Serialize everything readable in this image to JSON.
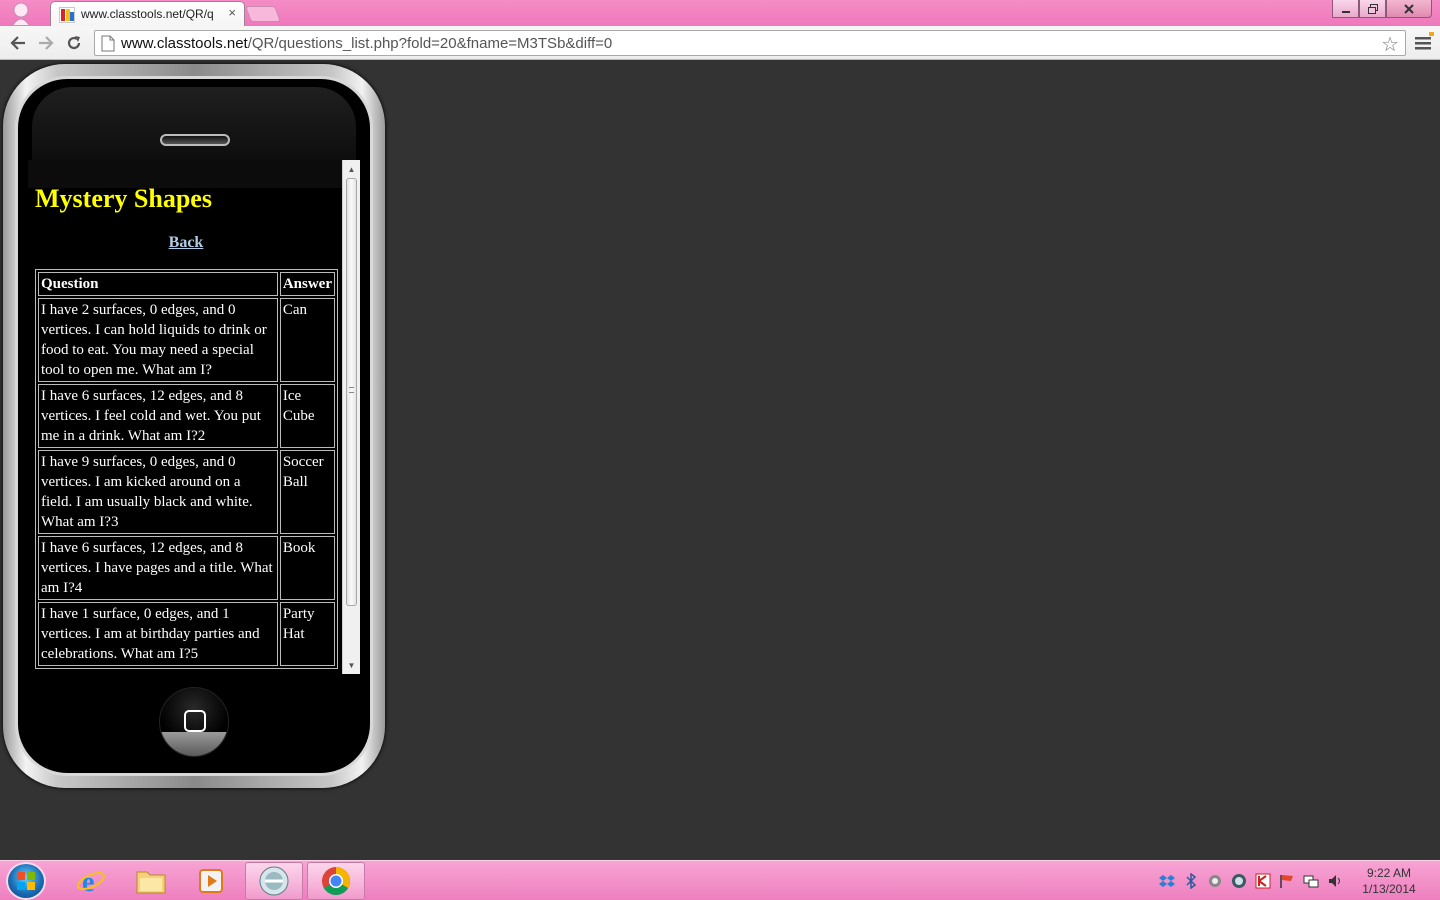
{
  "browser": {
    "tab_title": "www.classtools.net/QR/q",
    "tab_close": "×",
    "url_host": "www.classtools.net",
    "url_path": "/QR/questions_list.php?fold=20&fname=M3TSb&diff=0"
  },
  "page": {
    "title": "Mystery Shapes",
    "back_label": "Back",
    "table": {
      "headers": [
        "Question",
        "Answer"
      ],
      "rows": [
        {
          "question": "I have 2 surfaces, 0 edges, and 0 vertices. I can hold liquids to drink or food to eat. You may need a special tool to open me. What am I?",
          "answer": "Can"
        },
        {
          "question": "I have 6 surfaces, 12 edges, and 8 vertices. I feel cold and wet. You put me in a drink. What am I?2",
          "answer": "Ice Cube"
        },
        {
          "question": "I have 9 surfaces, 0 edges, and 0 vertices. I am kicked around on a field. I am usually black and white. What am I?3",
          "answer": "Soccer Ball"
        },
        {
          "question": "I have 6 surfaces, 12 edges, and 8 vertices. I have pages and a title. What am I?4",
          "answer": "Book"
        },
        {
          "question": "I have 1 surface, 0 edges, and 1 vertices. I am at birthday parties and celebrations. What am I?5",
          "answer": "Party Hat"
        }
      ]
    }
  },
  "taskbar": {
    "items": [
      "internet-explorer",
      "file-explorer",
      "media-player",
      "remote-desktop",
      "chrome"
    ],
    "clock_time": "9:22 AM",
    "clock_date": "1/13/2014"
  },
  "colors": {
    "title_yellow": "#ffff00",
    "link_blue": "#b0cde8",
    "chrome_pink": "#ee79bb",
    "desktop_bg": "#333333"
  }
}
